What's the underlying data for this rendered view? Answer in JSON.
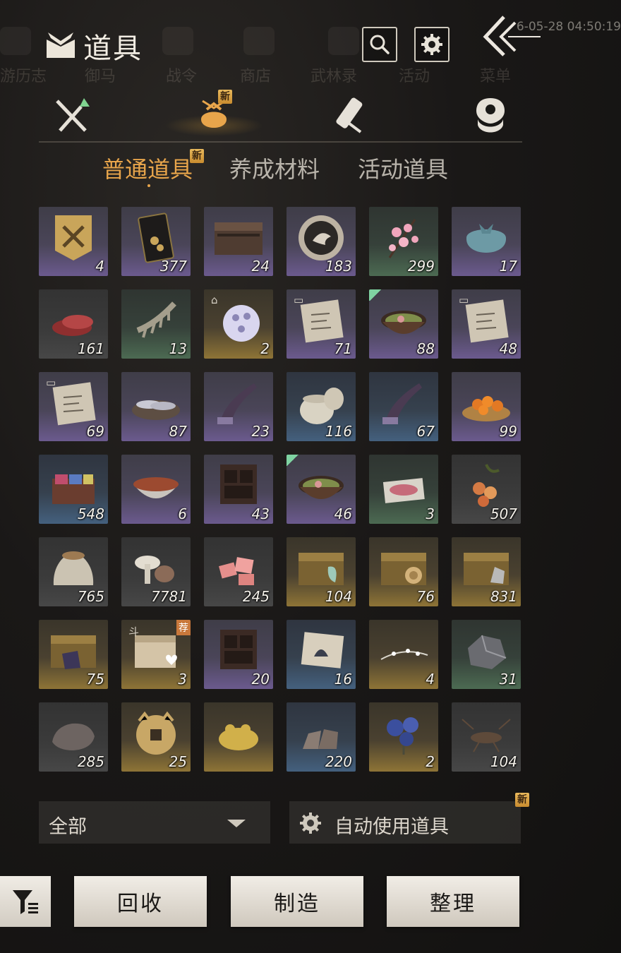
{
  "header": {
    "title": "道具",
    "timestamp": "6-05-28 04:50:19",
    "background_nav": [
      "游历志",
      "御马",
      "战令",
      "商店",
      "武林录",
      "活动",
      "菜单"
    ]
  },
  "category_tabs": [
    {
      "icon": "crossed-swords-icon",
      "active": false
    },
    {
      "icon": "pouch-icon",
      "active": true,
      "badge": "新"
    },
    {
      "icon": "scroll-icon",
      "active": false
    },
    {
      "icon": "token-icon",
      "active": false
    }
  ],
  "sub_tabs": [
    {
      "label": "普通道具",
      "active": true,
      "badge": "新"
    },
    {
      "label": "养成材料",
      "active": false
    },
    {
      "label": "活动道具",
      "active": false
    }
  ],
  "items": [
    {
      "name": "banner-item",
      "count": "4",
      "rarity": "purple"
    },
    {
      "name": "invitation-card-item",
      "count": "377",
      "rarity": "purple"
    },
    {
      "name": "wooden-chest-item",
      "count": "24",
      "rarity": "purple"
    },
    {
      "name": "medallion-item",
      "count": "183",
      "rarity": "purple"
    },
    {
      "name": "peach-blossom-item",
      "count": "299",
      "rarity": "green"
    },
    {
      "name": "cloth-bundle-item",
      "count": "17",
      "rarity": "purple"
    },
    {
      "name": "raw-meat-item",
      "count": "161",
      "rarity": "gray"
    },
    {
      "name": "bone-item",
      "count": "13",
      "rarity": "green"
    },
    {
      "name": "pearl-orb-item",
      "count": "2",
      "rarity": "gold"
    },
    {
      "name": "recipe-paper-item",
      "count": "71",
      "rarity": "purple"
    },
    {
      "name": "soup-bowl-item",
      "count": "88",
      "rarity": "purple"
    },
    {
      "name": "recipe-paper-item-2",
      "count": "48",
      "rarity": "purple"
    },
    {
      "name": "recipe-paper-item-3",
      "count": "69",
      "rarity": "purple"
    },
    {
      "name": "fish-platter-item",
      "count": "87",
      "rarity": "purple"
    },
    {
      "name": "horn-item",
      "count": "23",
      "rarity": "purple"
    },
    {
      "name": "jar-item",
      "count": "116",
      "rarity": "blue"
    },
    {
      "name": "horn-item-2",
      "count": "67",
      "rarity": "blue"
    },
    {
      "name": "fruit-plate-item",
      "count": "99",
      "rarity": "purple"
    },
    {
      "name": "powder-box-item",
      "count": "548",
      "rarity": "blue"
    },
    {
      "name": "meat-bowl-item",
      "count": "6",
      "rarity": "purple"
    },
    {
      "name": "cabinet-item",
      "count": "43",
      "rarity": "purple"
    },
    {
      "name": "soup-bowl-item-2",
      "count": "46",
      "rarity": "purple"
    },
    {
      "name": "sliced-meat-item",
      "count": "3",
      "rarity": "green"
    },
    {
      "name": "berries-item",
      "count": "507",
      "rarity": "gray"
    },
    {
      "name": "grain-sack-item",
      "count": "765",
      "rarity": "gray"
    },
    {
      "name": "mushroom-item",
      "count": "7781",
      "rarity": "gray"
    },
    {
      "name": "meat-chunks-item",
      "count": "245",
      "rarity": "gray"
    },
    {
      "name": "gold-chest-item",
      "count": "104",
      "rarity": "gold"
    },
    {
      "name": "gold-chest-item-2",
      "count": "76",
      "rarity": "gold"
    },
    {
      "name": "gold-chest-item-3",
      "count": "831",
      "rarity": "gold"
    },
    {
      "name": "gold-chest-item-4",
      "count": "75",
      "rarity": "gold"
    },
    {
      "name": "gift-box-item",
      "count": "3",
      "rarity": "gold"
    },
    {
      "name": "cabinet-item-2",
      "count": "20",
      "rarity": "purple"
    },
    {
      "name": "painting-scroll-item",
      "count": "16",
      "rarity": "blue"
    },
    {
      "name": "flower-branch-item",
      "count": "4",
      "rarity": "gold"
    },
    {
      "name": "ore-item",
      "count": "31",
      "rarity": "green"
    },
    {
      "name": "rock-item",
      "count": "285",
      "rarity": "gray"
    },
    {
      "name": "coin-item",
      "count": "25",
      "rarity": "gold"
    },
    {
      "name": "golden-toad-item",
      "count": "",
      "rarity": "gold"
    },
    {
      "name": "stone-pile-item",
      "count": "220",
      "rarity": "blue"
    },
    {
      "name": "blue-flower-item",
      "count": "2",
      "rarity": "gold"
    },
    {
      "name": "cricket-item",
      "count": "104",
      "rarity": "gray"
    }
  ],
  "item_tags": {
    "pearl_tag": "⌂",
    "recipe_tag": "▭",
    "soup_tag": "💧",
    "gift_box_tag": "斗",
    "gift_box_rec": "荐"
  },
  "footer": {
    "filter_select": "全部",
    "auto_use_label": "自动使用道具",
    "auto_use_badge": "新",
    "buttons": {
      "recycle": "回收",
      "craft": "制造",
      "organize": "整理"
    }
  },
  "colors": {
    "accent": "#e8a54b",
    "new_badge": "#d9a34a"
  }
}
